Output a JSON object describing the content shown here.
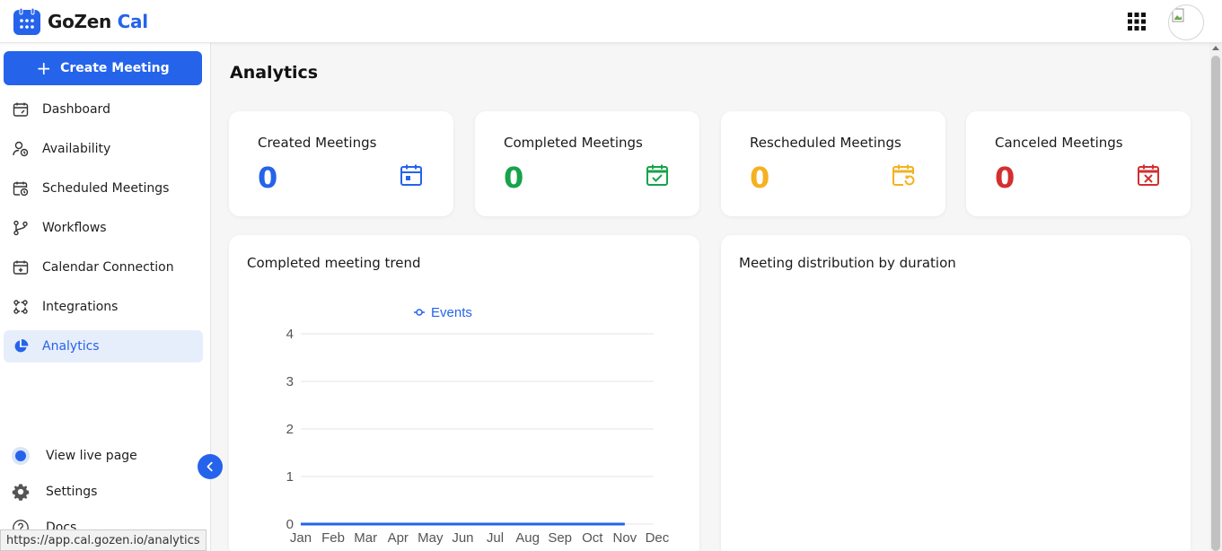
{
  "app": {
    "logo_primary": "GoZen",
    "logo_accent": "Cal",
    "brand_color": "#2563eb"
  },
  "header": {
    "apps_icon": "grid-icon",
    "avatar": "user-avatar"
  },
  "sidebar": {
    "create_label": "Create Meeting",
    "items": [
      {
        "label": "Dashboard",
        "icon": "dashboard-icon"
      },
      {
        "label": "Availability",
        "icon": "availability-icon"
      },
      {
        "label": "Scheduled Meetings",
        "icon": "calendar-clock-icon"
      },
      {
        "label": "Workflows",
        "icon": "workflow-icon"
      },
      {
        "label": "Calendar Connection",
        "icon": "calendar-plus-icon"
      },
      {
        "label": "Integrations",
        "icon": "integrations-icon"
      },
      {
        "label": "Analytics",
        "icon": "pie-chart-icon",
        "active": true
      }
    ],
    "bottom": {
      "live_label": "View live page",
      "settings_label": "Settings",
      "docs_label": "Docs"
    }
  },
  "status_bar": {
    "url": "https://app.cal.gozen.io/analytics"
  },
  "main": {
    "title": "Analytics",
    "stats": [
      {
        "label": "Created Meetings",
        "value": "0",
        "color": "#2563eb",
        "icon": "calendar-icon"
      },
      {
        "label": "Completed Meetings",
        "value": "0",
        "color": "#16a34a",
        "icon": "calendar-check-icon"
      },
      {
        "label": "Rescheduled Meetings",
        "value": "0",
        "color": "#f5b120",
        "icon": "calendar-reschedule-icon"
      },
      {
        "label": "Canceled Meetings",
        "value": "0",
        "color": "#d32f2f",
        "icon": "calendar-x-icon"
      }
    ],
    "trend_title": "Completed meeting trend",
    "distribution_title": "Meeting distribution by duration"
  },
  "chart_data": {
    "type": "line",
    "title": "",
    "categories": [
      "Jan",
      "Feb",
      "Mar",
      "Apr",
      "May",
      "Jun",
      "Jul",
      "Aug",
      "Sep",
      "Oct",
      "Nov",
      "Dec"
    ],
    "series": [
      {
        "name": "Events",
        "values": [
          0,
          0,
          0,
          0,
          0,
          0,
          0,
          0,
          0,
          0,
          0,
          null
        ],
        "color": "#2563eb"
      }
    ],
    "yticks": [
      "0",
      "1",
      "2",
      "3",
      "4"
    ],
    "ylim": [
      0,
      4
    ],
    "xlabel": "",
    "ylabel": "",
    "grid": true,
    "legend": "top-center"
  }
}
